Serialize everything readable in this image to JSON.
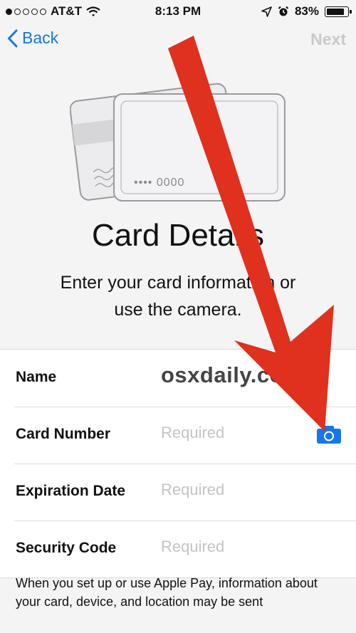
{
  "status_bar": {
    "carrier": "AT&T",
    "time": "8:13 PM",
    "battery": "83%",
    "signal_bars_filled": 1,
    "signal_bars_total": 5
  },
  "nav": {
    "back_label": "Back",
    "next_label": "Next"
  },
  "illustration": {
    "card_number_masked": "•••• 0000"
  },
  "page": {
    "title": "Card Details",
    "subtitle_line1": "Enter your card information or",
    "subtitle_line2": "use the camera."
  },
  "form": {
    "name_label": "Name",
    "name_value": "osxdaily.com",
    "card_number_label": "Card Number",
    "card_number_placeholder": "Required",
    "expiration_label": "Expiration Date",
    "expiration_placeholder": "Required",
    "security_label": "Security Code",
    "security_placeholder": "Required"
  },
  "footer": {
    "text": "When you set up or use Apple Pay, information about your card, device, and location may be sent"
  },
  "colors": {
    "accent": "#1677e8",
    "arrow": "#e0301e",
    "placeholder": "#c4c4c8",
    "next_disabled": "#c9c9cc"
  },
  "icons": [
    "wifi-icon",
    "location-icon",
    "alarm-icon",
    "battery-icon",
    "chevron-left-icon",
    "camera-icon",
    "red-arrow-overlay"
  ]
}
